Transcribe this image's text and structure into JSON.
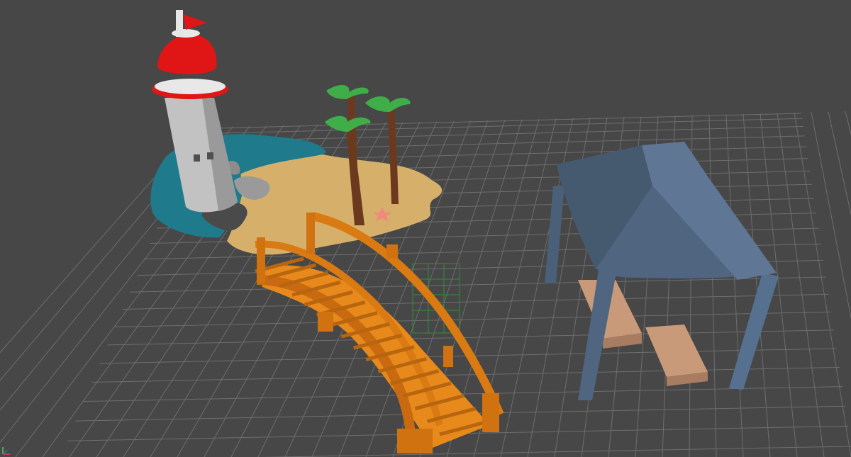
{
  "viewport": {
    "background": "#474747",
    "grid_color": "#6e6e6e",
    "grid_axis_color": "#5a5a5a"
  },
  "scene_objects": [
    {
      "name": "lighthouse",
      "colors": {
        "body": "#bfbfbf",
        "cap": "#e01616",
        "flag": "#e01616"
      }
    },
    {
      "name": "island",
      "colors": {
        "water": "#1f7a8c",
        "sand": "#d6b06a"
      }
    },
    {
      "name": "palm-trees",
      "count": 3,
      "colors": {
        "trunk": "#6b3a1e",
        "leaves": "#3fae49"
      }
    },
    {
      "name": "starfish",
      "colors": {
        "body": "#f08a7a"
      }
    },
    {
      "name": "rocks",
      "colors": {
        "body": "#4a4a4a"
      }
    },
    {
      "name": "wooden-bridge",
      "colors": {
        "wood": "#e8891c",
        "wood_dark": "#b8650f"
      }
    },
    {
      "name": "gazebo-canopy",
      "colors": {
        "roof": "#4f6580",
        "roof_light": "#5f7795"
      }
    },
    {
      "name": "wooden-benches",
      "count": 2,
      "colors": {
        "wood": "#c89a7a"
      }
    },
    {
      "name": "bounding-box-helper",
      "colors": {
        "line": "#2f8f3a"
      }
    }
  ],
  "axis_gizmo": {
    "colors": {
      "x": "#e04040",
      "y": "#40d040",
      "z": "#4060e0"
    }
  }
}
